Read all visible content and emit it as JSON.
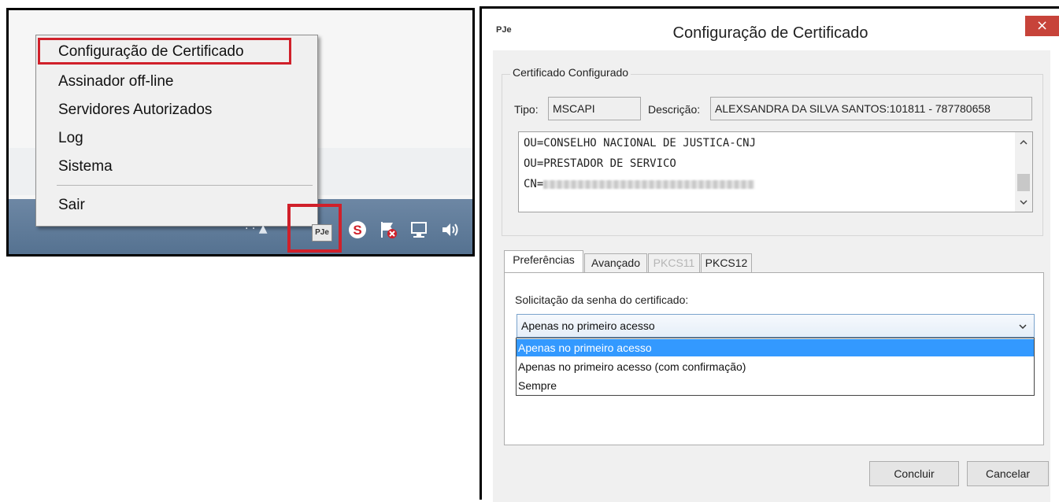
{
  "tray_menu": {
    "items": [
      {
        "label": "Configuração de Certificado"
      },
      {
        "label": "Assinador off-line"
      },
      {
        "label": "Servidores Autorizados"
      },
      {
        "label": "Log"
      },
      {
        "label": "Sistema"
      },
      {
        "label": "Sair"
      }
    ],
    "highlight_color": "#d0202a"
  },
  "tray": {
    "pje_icon_label": "PJe",
    "icons": [
      "pje-icon",
      "s-app-icon",
      "flag-error-icon",
      "network-icon",
      "speaker-icon"
    ]
  },
  "dialog": {
    "logo": "PJe",
    "title": "Configuração de Certificado",
    "close_glyph": "×",
    "cert_group": {
      "legend": "Certificado Configurado",
      "tipo_label": "Tipo:",
      "tipo_value": "MSCAPI",
      "descricao_label": "Descrição:",
      "descricao_value": "ALEXSANDRA DA SILVA SANTOS:101811 - 787780658",
      "dn_lines": [
        "OU=CONSELHO NACIONAL DE JUSTICA-CNJ",
        "OU=PRESTADOR DE SERVICO",
        "CN="
      ]
    },
    "tabs": [
      {
        "label": "Preferências",
        "state": "active"
      },
      {
        "label": "Avançado",
        "state": "normal"
      },
      {
        "label": "PKCS11",
        "state": "disabled"
      },
      {
        "label": "PKCS12",
        "state": "normal"
      }
    ],
    "password_label": "Solicitação da senha do certificado:",
    "combo_value": "Apenas no primeiro acesso",
    "options": [
      {
        "label": "Apenas no primeiro acesso",
        "selected": true
      },
      {
        "label": "Apenas no primeiro acesso (com confirmação)",
        "selected": false
      },
      {
        "label": "Sempre",
        "selected": false
      }
    ],
    "buttons": {
      "ok": "Concluir",
      "cancel": "Cancelar"
    }
  }
}
